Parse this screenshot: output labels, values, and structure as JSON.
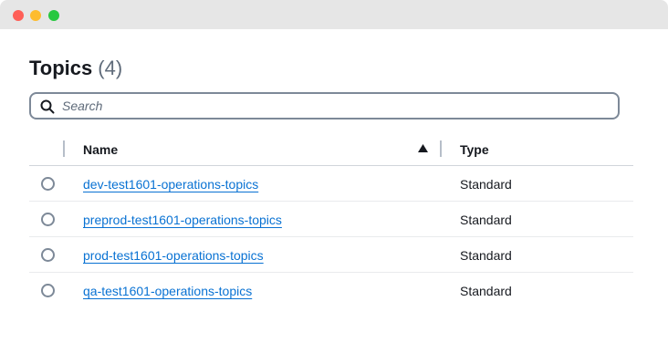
{
  "window": {
    "controls": [
      "close",
      "minimize",
      "maximize"
    ]
  },
  "header": {
    "title": "Topics",
    "count": "(4)"
  },
  "search": {
    "placeholder": "Search",
    "value": ""
  },
  "table": {
    "columns": {
      "name": "Name",
      "type": "Type"
    },
    "sort": {
      "column": "Name",
      "direction": "ascending"
    },
    "rows": [
      {
        "name": "dev-test1601-operations-topics",
        "type": "Standard"
      },
      {
        "name": "preprod-test1601-operations-topics",
        "type": "Standard"
      },
      {
        "name": "prod-test1601-operations-topics",
        "type": "Standard"
      },
      {
        "name": "qa-test1601-operations-topics",
        "type": "Standard"
      }
    ]
  },
  "colors": {
    "link": "#0972d3",
    "text": "#16191f",
    "muted": "#5f6b7a",
    "titlebar": "#e6e6e6"
  }
}
